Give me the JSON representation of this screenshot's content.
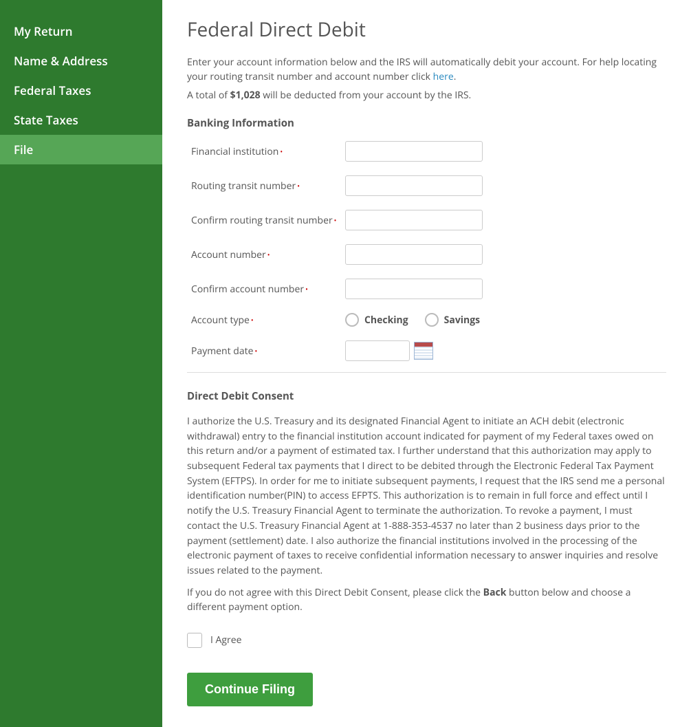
{
  "sidebar": {
    "items": [
      {
        "label": "My Return",
        "active": false
      },
      {
        "label": "Name & Address",
        "active": false
      },
      {
        "label": "Federal Taxes",
        "active": false
      },
      {
        "label": "State Taxes",
        "active": false
      },
      {
        "label": "File",
        "active": true
      }
    ]
  },
  "page": {
    "title": "Federal Direct Debit",
    "intro_before_link": "Enter your account information below and the IRS will automatically debit your account. For help locating your routing transit number and account number click ",
    "intro_link_text": "here",
    "intro_after_link": ".",
    "total_prefix": "A total of ",
    "total_amount": "$1,028",
    "total_suffix": " will be deducted from your account by the IRS."
  },
  "banking": {
    "heading": "Banking Information",
    "fields": {
      "financial_institution": {
        "label": "Financial institution",
        "value": ""
      },
      "routing": {
        "label": "Routing transit number",
        "value": ""
      },
      "confirm_routing": {
        "label": "Confirm routing transit number",
        "value": ""
      },
      "account_number": {
        "label": "Account number",
        "value": ""
      },
      "confirm_account_number": {
        "label": "Confirm account number",
        "value": ""
      },
      "account_type": {
        "label": "Account type",
        "options": {
          "checking": "Checking",
          "savings": "Savings"
        },
        "value": ""
      },
      "payment_date": {
        "label": "Payment date",
        "value": ""
      }
    }
  },
  "consent": {
    "heading": "Direct Debit Consent",
    "body": "I authorize the U.S. Treasury and its designated Financial Agent to initiate an ACH debit (electronic withdrawal) entry to the financial institution account indicated for payment of my Federal taxes owed on this return and/or a payment of estimated tax. I further understand that this authorization may apply to subsequent Federal tax payments that I direct to be debited through the Electronic Federal Tax Payment System (EFTPS). In order for me to initiate subsequent payments, I request that the IRS send me a personal identification number(PIN) to access EFPTS. This authorization is to remain in full force and effect until I notify the U.S. Treasury Financial Agent to terminate the authorization. To revoke a payment, I must contact the U.S. Treasury Financial Agent at 1-888-353-4537 no later than 2 business days prior to the payment (settlement) date. I also authorize the financial institutions involved in the processing of the electronic payment of taxes to receive confidential information necessary to answer inquiries and resolve issues related to the payment.",
    "disagree_before_bold": "If you do not agree with this Direct Debit Consent, please click the ",
    "disagree_bold": "Back",
    "disagree_after_bold": " button below and choose a different payment option.",
    "agree_label": "I Agree"
  },
  "actions": {
    "continue": "Continue Filing"
  }
}
